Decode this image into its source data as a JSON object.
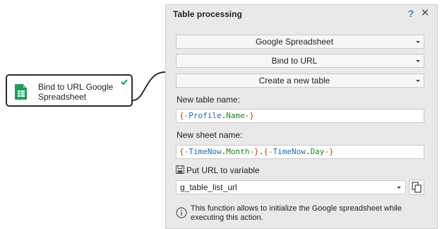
{
  "node": {
    "label_line1": "Bind to URL Google",
    "label_line2": "Spreadsheet",
    "icon": "google-sheets-icon",
    "status_icon": "checkmark-icon",
    "icon_color": "#1e9e5a"
  },
  "panel": {
    "title": "Table processing",
    "help": "?",
    "close": "✕"
  },
  "selects": {
    "service": "Google Spreadsheet",
    "action": "Bind to URL",
    "mode": "Create a new table"
  },
  "fields": {
    "table_name_label": "New table name:",
    "table_name_tokens": [
      "{-",
      "Profile",
      ".",
      "Name",
      "-}"
    ],
    "sheet_name_label": "New sheet name:",
    "sheet_name_tokens": [
      "{-",
      "TimeNow",
      ".",
      "Month",
      "-}",
      ".",
      "{-",
      "TimeNow",
      ".",
      "Day",
      "-}"
    ]
  },
  "variable": {
    "label": "Put URL to variable",
    "value": "g_table_list_url"
  },
  "info": {
    "text": "This function allows to initialize the Google spreadsheet while executing this action."
  },
  "colors": {
    "brace": "#c0392b",
    "variable": "#1e6bb8",
    "property": "#1a8a1a",
    "accent": "#3a7fd5"
  }
}
